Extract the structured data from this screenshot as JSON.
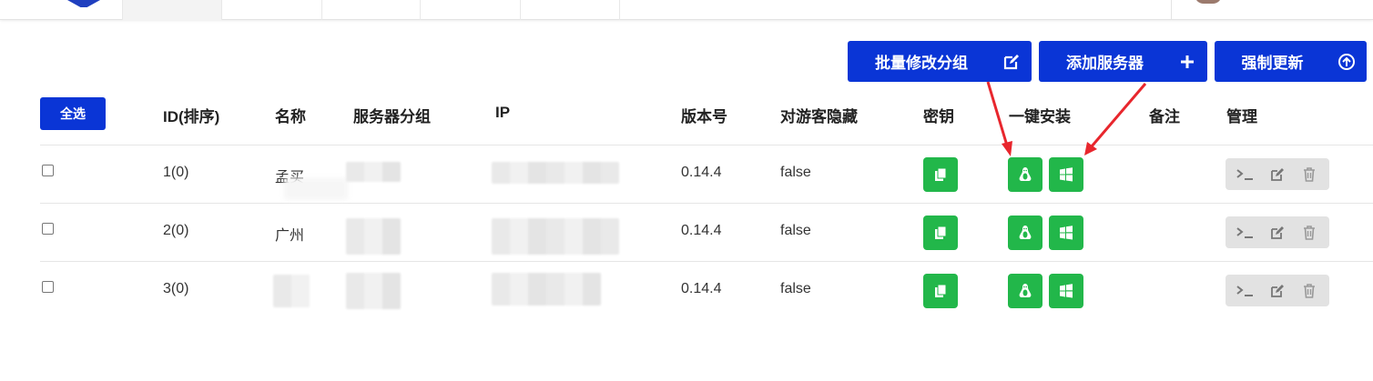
{
  "toolbar": {
    "batch_group_label": "批量修改分组",
    "add_server_label": "添加服务器",
    "force_update_label": "强制更新"
  },
  "select_all_label": "全选",
  "table": {
    "headers": [
      "ID(排序)",
      "名称",
      "服务器分组",
      "IP",
      "版本号",
      "对游客隐藏",
      "密钥",
      "一键安装",
      "备注",
      "管理"
    ],
    "rows": [
      {
        "id": "1(0)",
        "name": "孟买",
        "version": "0.14.4",
        "hidden": "false"
      },
      {
        "id": "2(0)",
        "name": "广州",
        "version": "0.14.4",
        "hidden": "false"
      },
      {
        "id": "3(0)",
        "name": "",
        "version": "0.14.4",
        "hidden": "false"
      }
    ]
  },
  "colors": {
    "primary": "#0a35d6",
    "success": "#22b74a",
    "annotation_arrow": "#e8262d"
  },
  "icons": {
    "batch_group": "edit-icon",
    "add_server": "plus-icon",
    "force_update": "upload-circle-icon",
    "key": "copy-icon",
    "install_linux": "linux-icon",
    "install_windows": "windows-icon",
    "terminal": "terminal-icon",
    "edit": "edit-icon",
    "delete": "trash-icon"
  }
}
